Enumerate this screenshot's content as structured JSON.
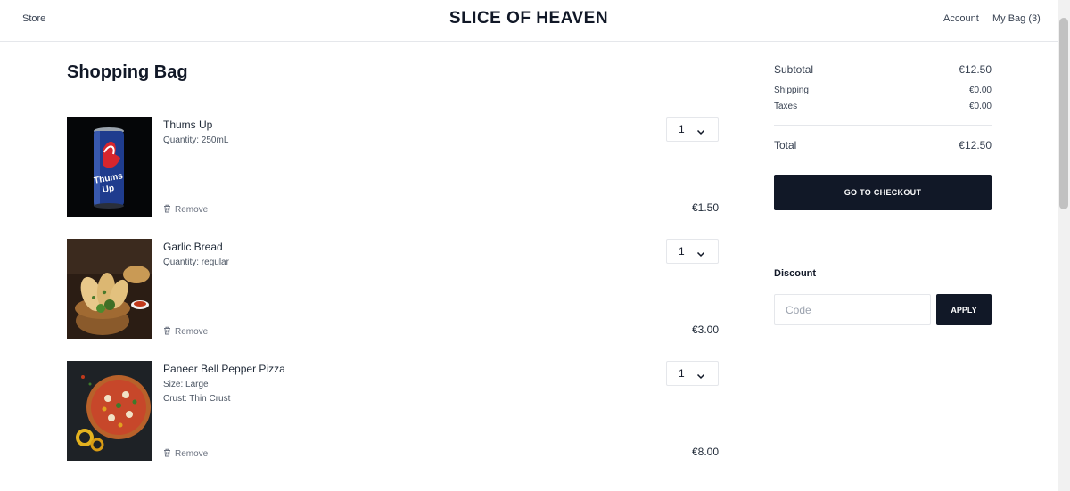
{
  "header": {
    "store_label": "Store",
    "brand": "SLICE OF HEAVEN",
    "account_label": "Account",
    "bag_label": "My Bag (3)"
  },
  "cart": {
    "title": "Shopping Bag",
    "remove_label": "Remove",
    "items": [
      {
        "name": "Thums Up",
        "options": [
          "Quantity: 250mL"
        ],
        "quantity": "1",
        "price": "€1.50",
        "image": "cola-can"
      },
      {
        "name": "Garlic Bread",
        "options": [
          "Quantity: regular"
        ],
        "quantity": "1",
        "price": "€3.00",
        "image": "garlic-bread-basket"
      },
      {
        "name": "Paneer Bell Pepper Pizza",
        "options": [
          "Size: Large",
          "Crust: Thin Crust"
        ],
        "quantity": "1",
        "price": "€8.00",
        "image": "pizza"
      }
    ]
  },
  "summary": {
    "subtotal_label": "Subtotal",
    "subtotal_value": "€12.50",
    "shipping_label": "Shipping",
    "shipping_value": "€0.00",
    "taxes_label": "Taxes",
    "taxes_value": "€0.00",
    "total_label": "Total",
    "total_value": "€12.50",
    "checkout_label": "GO TO CHECKOUT"
  },
  "discount": {
    "title": "Discount",
    "placeholder": "Code",
    "value": "",
    "apply_label": "APPLY"
  },
  "icons": {
    "remove": "trash-icon",
    "quantity": "chevron-down-icon"
  },
  "colors": {
    "primary": "#111827",
    "border": "#e5e7eb"
  }
}
